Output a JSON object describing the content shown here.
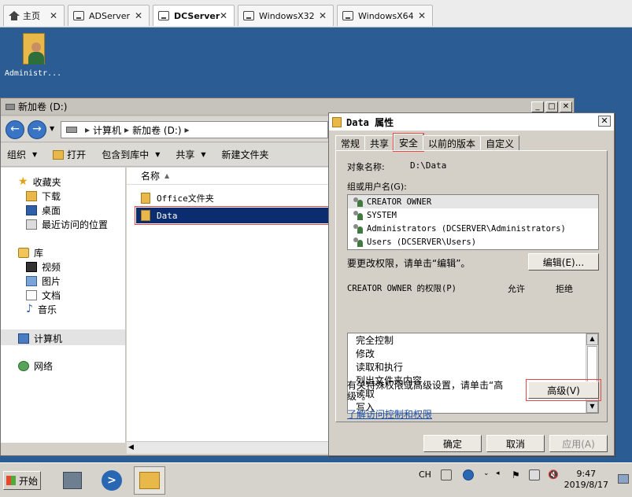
{
  "tabs": [
    {
      "label": "主页"
    },
    {
      "label": "ADServer"
    },
    {
      "label": "DCServer"
    },
    {
      "label": "WindowsX32"
    },
    {
      "label": "WindowsX64"
    }
  ],
  "desktop": {
    "icon_label": "Administr..."
  },
  "explorer": {
    "title": "新加卷 (D:)",
    "breadcrumb": [
      "计算机",
      "新加卷 (D:)"
    ],
    "toolbar": [
      "组织",
      "打开",
      "包含到库中",
      "共享",
      "新建文件夹"
    ],
    "nav": {
      "favorites": "收藏夹",
      "fav_items": [
        "下载",
        "桌面",
        "最近访问的位置"
      ],
      "libraries": "库",
      "lib_items": [
        "视频",
        "图片",
        "文档",
        "音乐"
      ],
      "computer": "计算机",
      "network": "网络"
    },
    "column_name": "名称",
    "files": [
      "Office文件夹",
      "Data"
    ]
  },
  "props": {
    "title": "Data 属性",
    "tabs": [
      "常规",
      "共享",
      "安全",
      "以前的版本",
      "自定义"
    ],
    "object_label": "对象名称:",
    "object_value": "D:\\Data",
    "group_label": "组或用户名(G):",
    "users": [
      "CREATOR OWNER",
      "SYSTEM",
      "Administrators (DCSERVER\\Administrators)",
      "Users (DCSERVER\\Users)"
    ],
    "change_hint": "要更改权限，请单击“编辑”。",
    "edit_btn": "编辑(E)...",
    "perm_label": "CREATOR OWNER 的权限(P)",
    "allow": "允许",
    "deny": "拒绝",
    "permissions": [
      "完全控制",
      "修改",
      "读取和执行",
      "列出文件夹内容",
      "读取",
      "写入"
    ],
    "advanced_hint": "有关特殊权限或高级设置，请单击“高级”。",
    "advanced_btn": "高级(V)",
    "link": "了解访问控制和权限",
    "ok": "确定",
    "cancel": "取消",
    "apply": "应用(A)"
  },
  "taskbar": {
    "start": "开始",
    "lang": "CH",
    "time": "9:47",
    "date": "2019/8/17"
  }
}
